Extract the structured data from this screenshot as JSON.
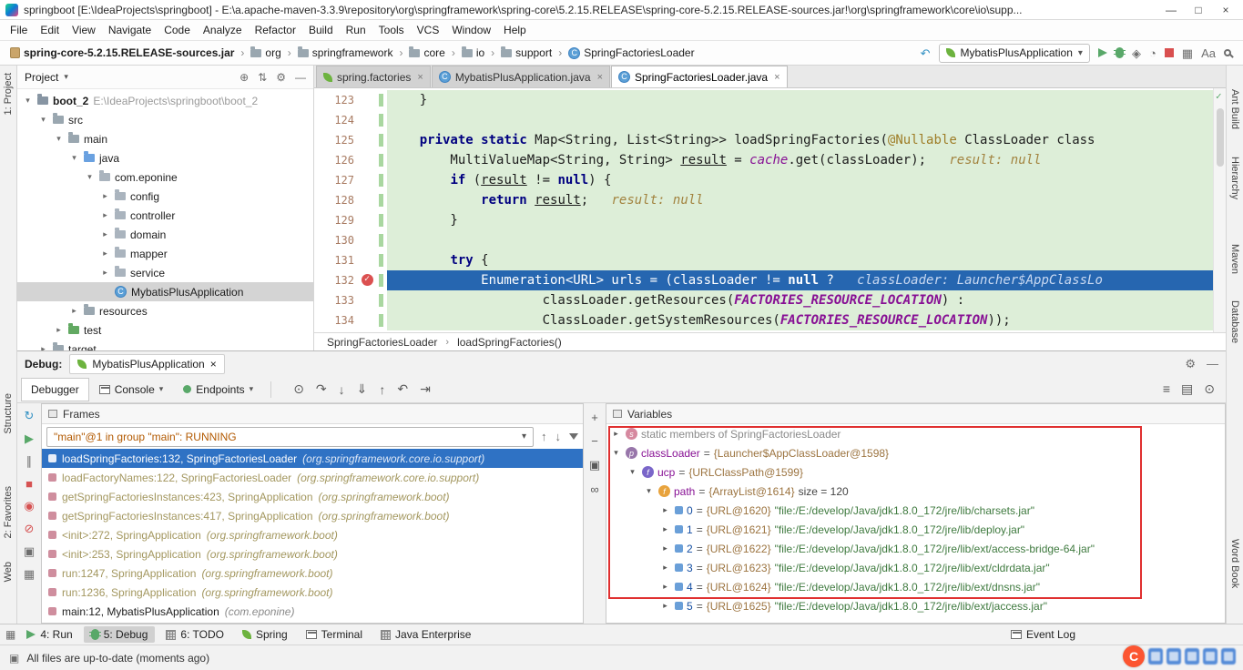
{
  "icons": {
    "minimize": "—",
    "maximize": "□",
    "close": "×",
    "gear": "⚙",
    "hide": "—",
    "locate": "⊕",
    "collapse": "⇅",
    "chevron": "›",
    "dropdown": "▾",
    "up": "↑",
    "down": "↓",
    "hamburger": "≡",
    "show-exec": "⊙",
    "step-over": "↷",
    "step-into": "↓",
    "force-step-into": "⇓",
    "step-out": "↑",
    "drop-frame": "↶",
    "run-to-cursor": "⇥",
    "grid": "▦",
    "grid2": "▤",
    "clock": "⊙",
    "plus": "+",
    "minus": "−",
    "copy": "▣",
    "infinity": "∞",
    "rerun": "↻",
    "resume": "▶",
    "pause": "∥",
    "stop": "■",
    "mute": "⊘",
    "bp": "◉",
    "camera": "▣",
    "undo": "↶",
    "coverage": "◈",
    "profiler": "◔",
    "translate": "Aa",
    "check": "✓",
    "switcher": "▦",
    "event": "◳",
    "doc": "▣"
  },
  "title_bar": {
    "title": "springboot [E:\\IdeaProjects\\springboot] - E:\\a.apache-maven-3.3.9\\repository\\org\\springframework\\spring-core\\5.2.15.RELEASE\\spring-core-5.2.15.RELEASE-sources.jar!\\org\\springframework\\core\\io\\supp..."
  },
  "menu_bar": [
    "File",
    "Edit",
    "View",
    "Navigate",
    "Code",
    "Analyze",
    "Refactor",
    "Build",
    "Run",
    "Tools",
    "VCS",
    "Window",
    "Help"
  ],
  "toolbar": {
    "breadcrumbs": [
      {
        "label": "spring-core-5.2.15.RELEASE-sources.jar",
        "icon": "jar-icon",
        "bold": true
      },
      {
        "label": "org",
        "icon": "folder-icon"
      },
      {
        "label": "springframework",
        "icon": "folder-icon"
      },
      {
        "label": "core",
        "icon": "folder-icon"
      },
      {
        "label": "io",
        "icon": "folder-icon"
      },
      {
        "label": "support",
        "icon": "folder-icon"
      },
      {
        "label": "SpringFactoriesLoader",
        "icon": "class-icon"
      }
    ],
    "run_config": "MybatisPlusApplication"
  },
  "project": {
    "title": "Project",
    "header_icons": [
      {
        "name": "locate-file-icon",
        "icon": "locate"
      },
      {
        "name": "collapse-all-icon",
        "icon": "collapse"
      },
      {
        "name": "settings-icon",
        "icon": "gear"
      },
      {
        "name": "hide-panel-icon",
        "icon": "hide"
      }
    ],
    "tree": [
      {
        "level": 0,
        "arrow": "v",
        "icon": "module-folder-icon",
        "label": "boot_2",
        "bold": true,
        "extra": "E:\\IdeaProjects\\springboot\\boot_2"
      },
      {
        "level": 1,
        "arrow": "v",
        "icon": "folder-icon",
        "label": "src"
      },
      {
        "level": 2,
        "arrow": "v",
        "icon": "folder-icon",
        "label": "main"
      },
      {
        "level": 3,
        "arrow": "v",
        "icon": "source-folder-icon",
        "label": "java"
      },
      {
        "level": 4,
        "arrow": "v",
        "icon": "package-icon",
        "label": "com.eponine"
      },
      {
        "level": 5,
        "arrow": ">",
        "icon": "package-icon",
        "label": "config"
      },
      {
        "level": 5,
        "arrow": ">",
        "icon": "package-icon",
        "label": "controller"
      },
      {
        "level": 5,
        "arrow": ">",
        "icon": "package-icon",
        "label": "domain"
      },
      {
        "level": 5,
        "arrow": ">",
        "icon": "package-icon",
        "label": "mapper"
      },
      {
        "level": 5,
        "arrow": ">",
        "icon": "package-icon",
        "label": "service"
      },
      {
        "level": 5,
        "arrow": "",
        "icon": "class-icon",
        "label": "MybatisPlusApplication",
        "selected": true
      },
      {
        "level": 3,
        "arrow": ">",
        "icon": "folder-icon",
        "label": "resources"
      },
      {
        "level": 2,
        "arrow": ">",
        "icon": "test-folder-icon",
        "label": "test"
      },
      {
        "level": 1,
        "arrow": ">",
        "icon": "folder-icon",
        "label": "target"
      }
    ]
  },
  "editor": {
    "tabs": [
      {
        "label": "spring.factories",
        "icon": "spring-factories-icon"
      },
      {
        "label": "MybatisPlusApplication.java",
        "icon": "class-icon"
      },
      {
        "label": "SpringFactoriesLoader.java",
        "icon": "class-icon",
        "active": true
      }
    ],
    "breadcrumb": [
      "SpringFactoriesLoader",
      "loadSpringFactories()"
    ],
    "lines": [
      {
        "num": 123,
        "tokens": [
          [
            "t",
            "    }"
          ]
        ]
      },
      {
        "num": 124,
        "tokens": []
      },
      {
        "num": 125,
        "tokens": [
          [
            "t",
            "    "
          ],
          [
            "k",
            "private"
          ],
          [
            "t",
            " "
          ],
          [
            "k",
            "static"
          ],
          [
            "t",
            " Map<String, List<String>> loadSpringFactories("
          ],
          [
            "a",
            "@Nullable"
          ],
          [
            "t",
            " ClassLoader class"
          ]
        ]
      },
      {
        "num": 126,
        "tokens": [
          [
            "t",
            "        MultiValueMap<String, String> "
          ],
          [
            "u",
            "result"
          ],
          [
            "t",
            " = "
          ],
          [
            "f",
            "cache"
          ],
          [
            "t",
            ".get(classLoader);   "
          ],
          [
            "h",
            "result: null"
          ]
        ]
      },
      {
        "num": 127,
        "tokens": [
          [
            "t",
            "        "
          ],
          [
            "k",
            "if"
          ],
          [
            "t",
            " ("
          ],
          [
            "u",
            "result"
          ],
          [
            "t",
            " != "
          ],
          [
            "k",
            "null"
          ],
          [
            "t",
            ") {"
          ]
        ]
      },
      {
        "num": 128,
        "tokens": [
          [
            "t",
            "            "
          ],
          [
            "k",
            "return"
          ],
          [
            "t",
            " "
          ],
          [
            "u",
            "result"
          ],
          [
            "t",
            ";   "
          ],
          [
            "h",
            "result: null"
          ]
        ]
      },
      {
        "num": 129,
        "tokens": [
          [
            "t",
            "        }"
          ]
        ]
      },
      {
        "num": 130,
        "tokens": []
      },
      {
        "num": 131,
        "tokens": [
          [
            "t",
            "        "
          ],
          [
            "k",
            "try"
          ],
          [
            "t",
            " {"
          ]
        ]
      },
      {
        "num": 132,
        "exec": true,
        "bp": true,
        "tokens": [
          [
            "t",
            "            Enumeration<URL> urls = (classLoader != "
          ],
          [
            "k",
            "null"
          ],
          [
            "t",
            " ?   "
          ],
          [
            "h",
            "classLoader: Launcher$AppClassLo"
          ]
        ]
      },
      {
        "num": 133,
        "tokens": [
          [
            "t",
            "                    classLoader.getResources("
          ],
          [
            "c",
            "FACTORIES_RESOURCE_LOCATION"
          ],
          [
            "t",
            ") :"
          ]
        ]
      },
      {
        "num": 134,
        "tokens": [
          [
            "t",
            "                    ClassLoader.getSystemResources("
          ],
          [
            "c",
            "FACTORIES_RESOURCE_LOCATION"
          ],
          [
            "t",
            "));"
          ]
        ]
      }
    ]
  },
  "debug": {
    "header": {
      "label": "Debug:",
      "tab": "MybatisPlusApplication"
    },
    "tabs": [
      {
        "label": "Debugger",
        "active": true
      },
      {
        "label": "Console",
        "icon": "console-icon",
        "dropdown": true
      },
      {
        "label": "Endpoints",
        "icon": "endpoints-icon",
        "dropdown": true
      }
    ],
    "controls": [
      {
        "name": "rerun-button",
        "icon": "rerun",
        "tone": "teal"
      },
      {
        "name": "resume-button",
        "icon": "resume",
        "tone": "green"
      },
      {
        "name": "pause-button",
        "icon": "pause",
        "tone": "gray"
      },
      {
        "name": "stop-button",
        "icon": "stop",
        "tone": "red"
      },
      {
        "name": "view-breakpoints-button",
        "icon": "bp",
        "tone": "red"
      },
      {
        "name": "mute-breakpoints-button",
        "icon": "mute",
        "tone": "red"
      },
      {
        "name": "thread-dump-button",
        "icon": "camera",
        "tone": "gray"
      },
      {
        "name": "layout-button",
        "icon": "grid",
        "tone": "gray"
      }
    ],
    "steps": [
      {
        "name": "show-execution-point-button",
        "icon": "show-exec"
      },
      {
        "name": "step-over-button",
        "icon": "step-over"
      },
      {
        "name": "step-into-button",
        "icon": "step-into"
      },
      {
        "name": "force-step-into-button",
        "icon": "force-step-into"
      },
      {
        "name": "step-out-button",
        "icon": "step-out"
      },
      {
        "name": "drop-frame-button",
        "icon": "drop-frame"
      },
      {
        "name": "run-to-cursor-button",
        "icon": "run-to-cursor"
      }
    ],
    "view_icons": [
      {
        "name": "layout-settings-button",
        "icon": "hamburger"
      },
      {
        "name": "table-view-button",
        "icon": "grid2"
      },
      {
        "name": "history-button",
        "icon": "clock"
      }
    ]
  },
  "frames": {
    "title": "Frames",
    "thread_selector": "\"main\"@1 in group \"main\": RUNNING",
    "items": [
      {
        "method": "loadSpringFactories:132, SpringFactoriesLoader",
        "pkg": "(org.springframework.core.io.support)",
        "selected": true
      },
      {
        "method": "loadFactoryNames:122, SpringFactoriesLoader",
        "pkg": "(org.springframework.core.io.support)",
        "lib": true
      },
      {
        "method": "getSpringFactoriesInstances:423, SpringApplication",
        "pkg": "(org.springframework.boot)",
        "lib": true
      },
      {
        "method": "getSpringFactoriesInstances:417, SpringApplication",
        "pkg": "(org.springframework.boot)",
        "lib": true
      },
      {
        "method": "<init>:272, SpringApplication",
        "pkg": "(org.springframework.boot)",
        "lib": true
      },
      {
        "method": "<init>:253, SpringApplication",
        "pkg": "(org.springframework.boot)",
        "lib": true
      },
      {
        "method": "run:1247, SpringApplication",
        "pkg": "(org.springframework.boot)",
        "lib": true
      },
      {
        "method": "run:1236, SpringApplication",
        "pkg": "(org.springframework.boot)",
        "lib": true
      },
      {
        "method": "main:12, MybatisPlusApplication",
        "pkg": "(com.eponine)",
        "lib": false
      }
    ]
  },
  "watches": {
    "controls": [
      {
        "name": "add-watch-button",
        "icon": "plus"
      },
      {
        "name": "remove-watch-button",
        "icon": "minus"
      },
      {
        "name": "copy-value-button",
        "icon": "copy"
      },
      {
        "name": "show-watches-button",
        "icon": "infinity"
      }
    ]
  },
  "variables": {
    "title": "Variables",
    "rows": [
      {
        "indent": 0,
        "arrow": ">",
        "icon": "static-icon",
        "badge": "s",
        "parts": [
          [
            "gray",
            "static members of SpringFactoriesLoader"
          ]
        ]
      },
      {
        "indent": 0,
        "arrow": "v",
        "icon": "parameter-icon",
        "badge": "p",
        "parts": [
          [
            "name",
            "classLoader"
          ],
          [
            "eq",
            " = "
          ],
          [
            "val",
            "{Launcher$AppClassLoader@1598}"
          ]
        ]
      },
      {
        "indent": 1,
        "arrow": "v",
        "icon": "field-icon",
        "badge": "f",
        "parts": [
          [
            "name",
            "ucp"
          ],
          [
            "eq",
            " = "
          ],
          [
            "val",
            "{URLClassPath@1599}"
          ]
        ]
      },
      {
        "indent": 2,
        "arrow": "v",
        "icon": "field-orange-icon",
        "badge": "f",
        "parts": [
          [
            "name",
            "path"
          ],
          [
            "eq",
            " = "
          ],
          [
            "val",
            "{ArrayList@1614}"
          ],
          [
            "size",
            "  size = 120"
          ]
        ]
      },
      {
        "indent": 3,
        "arrow": ">",
        "icon": "index-icon",
        "badge": "",
        "parts": [
          [
            "idx",
            "0"
          ],
          [
            "eq",
            " = "
          ],
          [
            "val",
            "{URL@1620}"
          ],
          [
            "str",
            " \"file:/E:/develop/Java/jdk1.8.0_172/jre/lib/charsets.jar\""
          ]
        ]
      },
      {
        "indent": 3,
        "arrow": ">",
        "icon": "index-icon",
        "badge": "",
        "parts": [
          [
            "idx",
            "1"
          ],
          [
            "eq",
            " = "
          ],
          [
            "val",
            "{URL@1621}"
          ],
          [
            "str",
            " \"file:/E:/develop/Java/jdk1.8.0_172/jre/lib/deploy.jar\""
          ]
        ]
      },
      {
        "indent": 3,
        "arrow": ">",
        "icon": "index-icon",
        "badge": "",
        "parts": [
          [
            "idx",
            "2"
          ],
          [
            "eq",
            " = "
          ],
          [
            "val",
            "{URL@1622}"
          ],
          [
            "str",
            " \"file:/E:/develop/Java/jdk1.8.0_172/jre/lib/ext/access-bridge-64.jar\""
          ]
        ]
      },
      {
        "indent": 3,
        "arrow": ">",
        "icon": "index-icon",
        "badge": "",
        "parts": [
          [
            "idx",
            "3"
          ],
          [
            "eq",
            " = "
          ],
          [
            "val",
            "{URL@1623}"
          ],
          [
            "str",
            " \"file:/E:/develop/Java/jdk1.8.0_172/jre/lib/ext/cldrdata.jar\""
          ]
        ]
      },
      {
        "indent": 3,
        "arrow": ">",
        "icon": "index-icon",
        "badge": "",
        "parts": [
          [
            "idx",
            "4"
          ],
          [
            "eq",
            " = "
          ],
          [
            "val",
            "{URL@1624}"
          ],
          [
            "str",
            " \"file:/E:/develop/Java/jdk1.8.0_172/jre/lib/ext/dnsns.jar\""
          ]
        ]
      },
      {
        "indent": 3,
        "arrow": ">",
        "icon": "index-icon",
        "badge": "",
        "parts": [
          [
            "idx",
            "5"
          ],
          [
            "eq",
            " = "
          ],
          [
            "val",
            "{URL@1625}"
          ],
          [
            "str",
            " \"file:/E:/develop/Java/jdk1.8.0_172/jre/lib/ext/jaccess.jar\""
          ]
        ]
      }
    ]
  },
  "left_strip": {
    "top": [
      {
        "label": "1: Project"
      }
    ],
    "bottom": [
      {
        "label": "Structure"
      },
      {
        "label": "2: Favorites"
      },
      {
        "label": "Web"
      }
    ]
  },
  "right_strip": [
    {
      "label": "Ant Build"
    },
    {
      "label": "Hierarchy"
    },
    {
      "label": "Maven"
    },
    {
      "label": "Database"
    },
    {
      "label": "Word Book"
    }
  ],
  "bottom_bar": {
    "items": [
      {
        "label": "4: Run",
        "icon": "run-tool-icon"
      },
      {
        "label": "5: Debug",
        "icon": "debug-tool-icon",
        "active": true
      },
      {
        "label": "6: TODO",
        "icon": "todo-icon"
      },
      {
        "label": "Spring",
        "icon": "spring-leaf-icon"
      },
      {
        "label": "Terminal",
        "icon": "terminal-icon"
      },
      {
        "label": "Java Enterprise",
        "icon": "javaee-icon"
      }
    ],
    "right": [
      {
        "label": "Event Log",
        "icon": "event-log-icon"
      }
    ]
  },
  "status_bar": {
    "message": "All files are up-to-date (moments ago)"
  }
}
